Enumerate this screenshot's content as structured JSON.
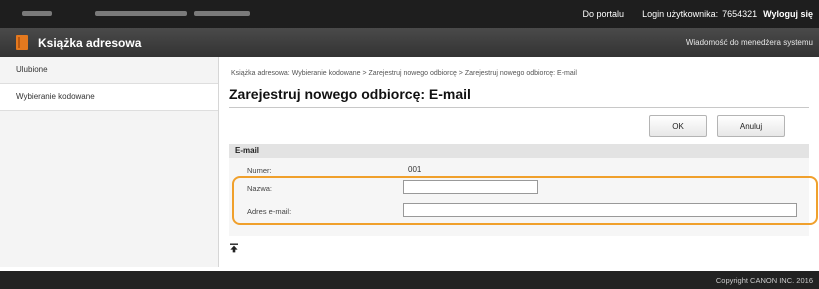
{
  "topbar": {
    "portal_link": "Do portalu",
    "login_label": "Login użytkownika:",
    "login_user": "7654321",
    "logout_link": "Wyloguj się"
  },
  "titlebar": {
    "app_icon": "address-book-icon",
    "title": "Książka adresowa",
    "admin_message_link": "Wiadomość do menedżera systemu"
  },
  "sidebar": {
    "items": [
      {
        "label": "Ulubione",
        "selected": false
      },
      {
        "label": "Wybieranie kodowane",
        "selected": true
      }
    ]
  },
  "main": {
    "breadcrumb": {
      "items": [
        "Książka adresowa: Wybieranie kodowane",
        "Zarejestruj nowego odbiorcę",
        "Zarejestruj nowego odbiorcę: E-mail"
      ],
      "separator": ">"
    },
    "title": "Zarejestruj nowego odbiorcę: E-mail",
    "buttons": {
      "ok": "OK",
      "cancel": "Anuluj"
    },
    "section": {
      "title": "E-mail",
      "number_label": "Numer:",
      "number_value": "001",
      "name_label": "Nazwa:",
      "name_value": "",
      "email_label": "Adres e-mail:",
      "email_value": ""
    },
    "top_link_icon": "scroll-to-top-icon"
  },
  "footer": {
    "copyright": "Copyright CANON INC. 2016"
  },
  "colors": {
    "topbar": "#1e1e1e",
    "titlebar": "#3c3c3c",
    "accent_icon": "#e5791e",
    "highlight_outline": "#f0a02c",
    "footer": "#222222"
  }
}
